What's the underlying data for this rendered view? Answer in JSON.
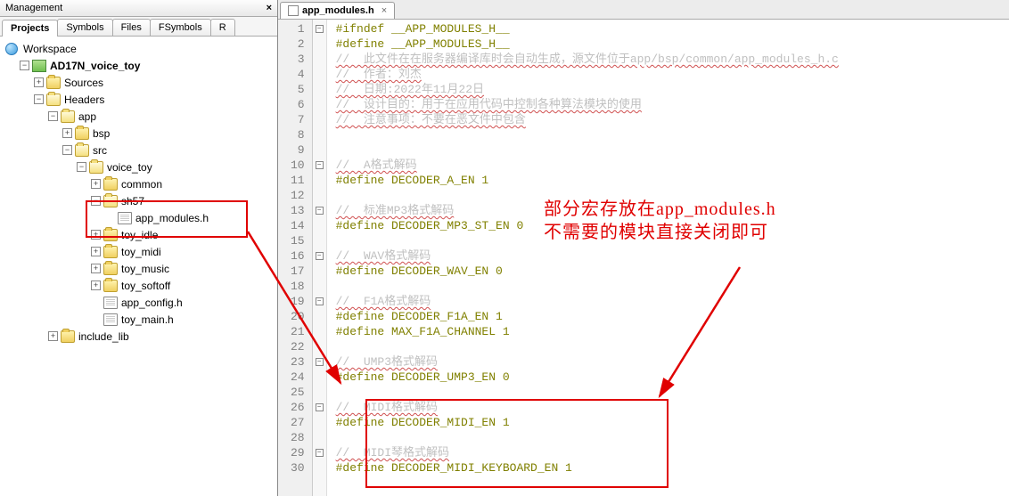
{
  "sidebar": {
    "title": "Management",
    "tabs": [
      "Projects",
      "Symbols",
      "Files",
      "FSymbols",
      "R"
    ],
    "root": "Workspace",
    "tree": {
      "project": "AD17N_voice_toy",
      "sources": "Sources",
      "headers": "Headers",
      "app": "app",
      "bsp": "bsp",
      "src": "src",
      "voice_toy": "voice_toy",
      "common": "common",
      "sh57": "sh57",
      "app_modules": "app_modules.h",
      "toy_idle": "toy_idle",
      "toy_midi": "toy_midi",
      "toy_music": "toy_music",
      "toy_softoff": "toy_softoff",
      "app_config": "app_config.h",
      "toy_main": "toy_main.h",
      "include_lib": "include_lib"
    }
  },
  "editor": {
    "tab_title": "app_modules.h",
    "lines": [
      {
        "n": 1,
        "type": "olive",
        "text": "#ifndef __APP_MODULES_H__"
      },
      {
        "n": 2,
        "type": "olive",
        "text": "#define __APP_MODULES_H__"
      },
      {
        "n": 3,
        "type": "wavy",
        "text": "//  此文件在在服务器编译库时会自动生成，源文件位于app/bsp/common/app_modules_h.c"
      },
      {
        "n": 4,
        "type": "wavy",
        "text": "//  作者：刘杰"
      },
      {
        "n": 5,
        "type": "wavy",
        "text": "//  日期:2022年11月22日"
      },
      {
        "n": 6,
        "type": "wavy",
        "text": "//  设计目的：用于在应用代码中控制各种算法模块的使用"
      },
      {
        "n": 7,
        "type": "wavy",
        "text": "//  注意事项：不要在恶文件中包含"
      },
      {
        "n": 8,
        "type": "blank",
        "text": ""
      },
      {
        "n": 9,
        "type": "blank",
        "text": ""
      },
      {
        "n": 10,
        "type": "wavy",
        "text": "//  A格式解码"
      },
      {
        "n": 11,
        "type": "olive",
        "text": "#define DECODER_A_EN 1"
      },
      {
        "n": 12,
        "type": "blank",
        "text": ""
      },
      {
        "n": 13,
        "type": "wavy",
        "text": "//  标准MP3格式解码"
      },
      {
        "n": 14,
        "type": "olive",
        "text": "#define DECODER_MP3_ST_EN 0"
      },
      {
        "n": 15,
        "type": "blank",
        "text": ""
      },
      {
        "n": 16,
        "type": "wavy",
        "text": "//  WAV格式解码"
      },
      {
        "n": 17,
        "type": "olive",
        "text": "#define DECODER_WAV_EN 0"
      },
      {
        "n": 18,
        "type": "blank",
        "text": ""
      },
      {
        "n": 19,
        "type": "wavy",
        "text": "//  F1A格式解码"
      },
      {
        "n": 20,
        "type": "olive",
        "text": "#define DECODER_F1A_EN 1"
      },
      {
        "n": 21,
        "type": "olive",
        "text": "#define MAX_F1A_CHANNEL 1"
      },
      {
        "n": 22,
        "type": "blank",
        "text": ""
      },
      {
        "n": 23,
        "type": "wavy",
        "text": "//  UMP3格式解码"
      },
      {
        "n": 24,
        "type": "olive",
        "text": "#define DECODER_UMP3_EN 0"
      },
      {
        "n": 25,
        "type": "blank",
        "text": ""
      },
      {
        "n": 26,
        "type": "wavy",
        "text": "//  MIDI格式解码"
      },
      {
        "n": 27,
        "type": "olive",
        "text": "#define DECODER_MIDI_EN 1"
      },
      {
        "n": 28,
        "type": "blank",
        "text": ""
      },
      {
        "n": 29,
        "type": "wavy",
        "text": "//  MIDI琴格式解码"
      },
      {
        "n": 30,
        "type": "olive",
        "text": "#define DECODER_MIDI_KEYBOARD_EN 1"
      }
    ]
  },
  "annotation": {
    "line1": "部分宏存放在app_modules.h",
    "line2": "不需要的模块直接关闭即可"
  }
}
